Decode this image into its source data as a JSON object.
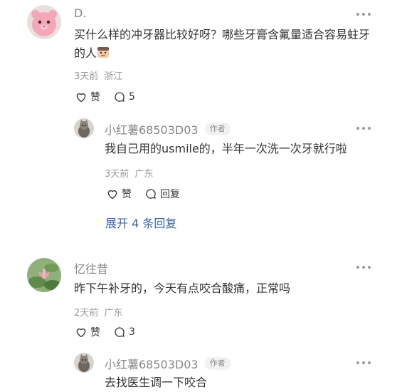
{
  "comments": [
    {
      "author": "D.",
      "avatar_icon": "pink-plush-avatar",
      "text": "买什么样的冲牙器比较好呀？哪些牙膏含氟量适合容易蛀牙的人",
      "emoji_icon": "face-emoji-icon",
      "time": "3天前",
      "location": "浙江",
      "like_label": "赞",
      "reply_count": "5",
      "more_icon": "more-dots-icon",
      "reply": {
        "author": "小红薯68503D03",
        "tag": "作者",
        "avatar_icon": "cat-avatar",
        "text": "我自己用的usmile的，半年一次洗一次牙就行啦",
        "time": "3天前",
        "location": "广东",
        "like_label": "赞",
        "reply_label": "回复"
      },
      "expand_label": "展开 4 条回复"
    },
    {
      "author": "忆往昔",
      "avatar_icon": "lotus-avatar",
      "text": "昨下午补牙的，今天有点咬合酸痛，正常吗",
      "time": "2天前",
      "location": "广东",
      "like_label": "赞",
      "reply_count": "3",
      "more_icon": "more-dots-icon",
      "reply": {
        "author": "小红薯68503D03",
        "tag": "作者",
        "avatar_icon": "cat-avatar",
        "text": "去找医生调一下咬合"
      }
    }
  ],
  "colors": {
    "link": "#3a64a8",
    "muted": "#999999",
    "text": "#333333"
  }
}
